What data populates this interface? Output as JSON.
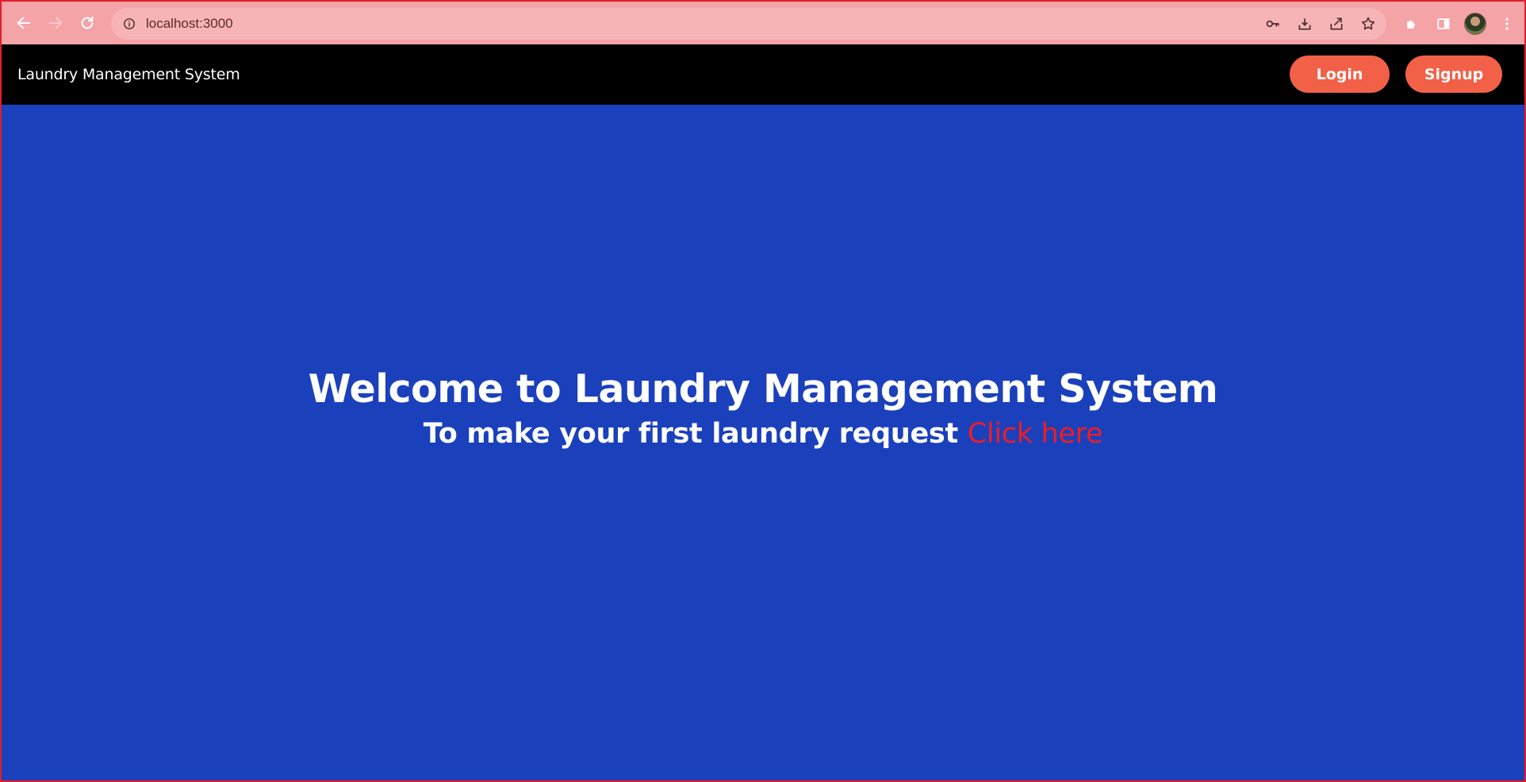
{
  "browser": {
    "url": "localhost:3000",
    "icons": [
      "back-icon",
      "forward-icon",
      "reload-icon",
      "info-icon",
      "key-icon",
      "install-icon",
      "share-icon",
      "star-icon",
      "extensions-icon",
      "side-panel-icon",
      "avatar",
      "menu-icon"
    ]
  },
  "navbar": {
    "brand": "Laundry Management System",
    "login_label": "Login",
    "signup_label": "Signup"
  },
  "hero": {
    "title": "Welcome to Laundry Management System",
    "subtitle": "To make your first laundry request",
    "link_label": "Click here"
  },
  "colors": {
    "chrome": "#f4a3a6",
    "navbar": "#000000",
    "accent_button": "#f26048",
    "main_background": "#1b40bc",
    "link": "#ee1c25"
  }
}
